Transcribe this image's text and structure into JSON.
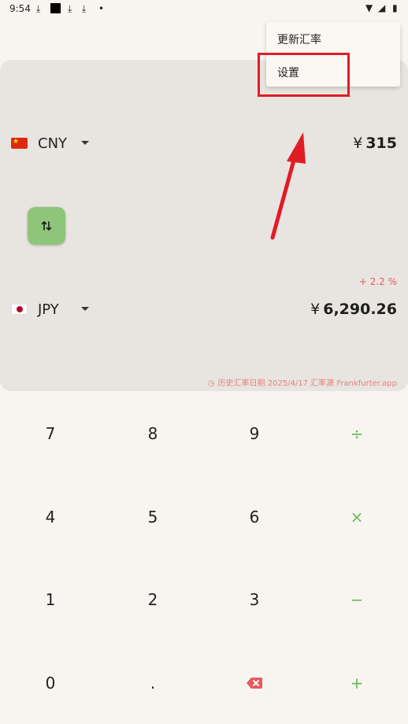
{
  "status_bar": {
    "time": "9:54",
    "icons": [
      "download-icon",
      "stop-icon",
      "download-icon",
      "download-icon",
      "dot-icon"
    ],
    "right_icons": [
      "wifi-icon",
      "signal-icon",
      "battery-icon"
    ]
  },
  "converter": {
    "from": {
      "code": "CNY",
      "symbol": "¥",
      "amount": "315"
    },
    "to": {
      "code": "JPY",
      "symbol": "¥",
      "amount": "6,290.26"
    },
    "change": "+ 2.2 %",
    "history_note": "历史汇率日期 2025/4/17 汇率源 Frankfurter.app"
  },
  "keypad": {
    "keys": [
      "7",
      "8",
      "9",
      "÷",
      "4",
      "5",
      "6",
      "×",
      "1",
      "2",
      "3",
      "−",
      "0",
      ".",
      "⌫",
      "+"
    ]
  },
  "menu": {
    "items": [
      "更新汇率",
      "设置"
    ]
  },
  "colors": {
    "accent": "#8fc57a",
    "danger": "#e11c24",
    "background": "#f8f5f1",
    "card": "#e8e5e1"
  }
}
